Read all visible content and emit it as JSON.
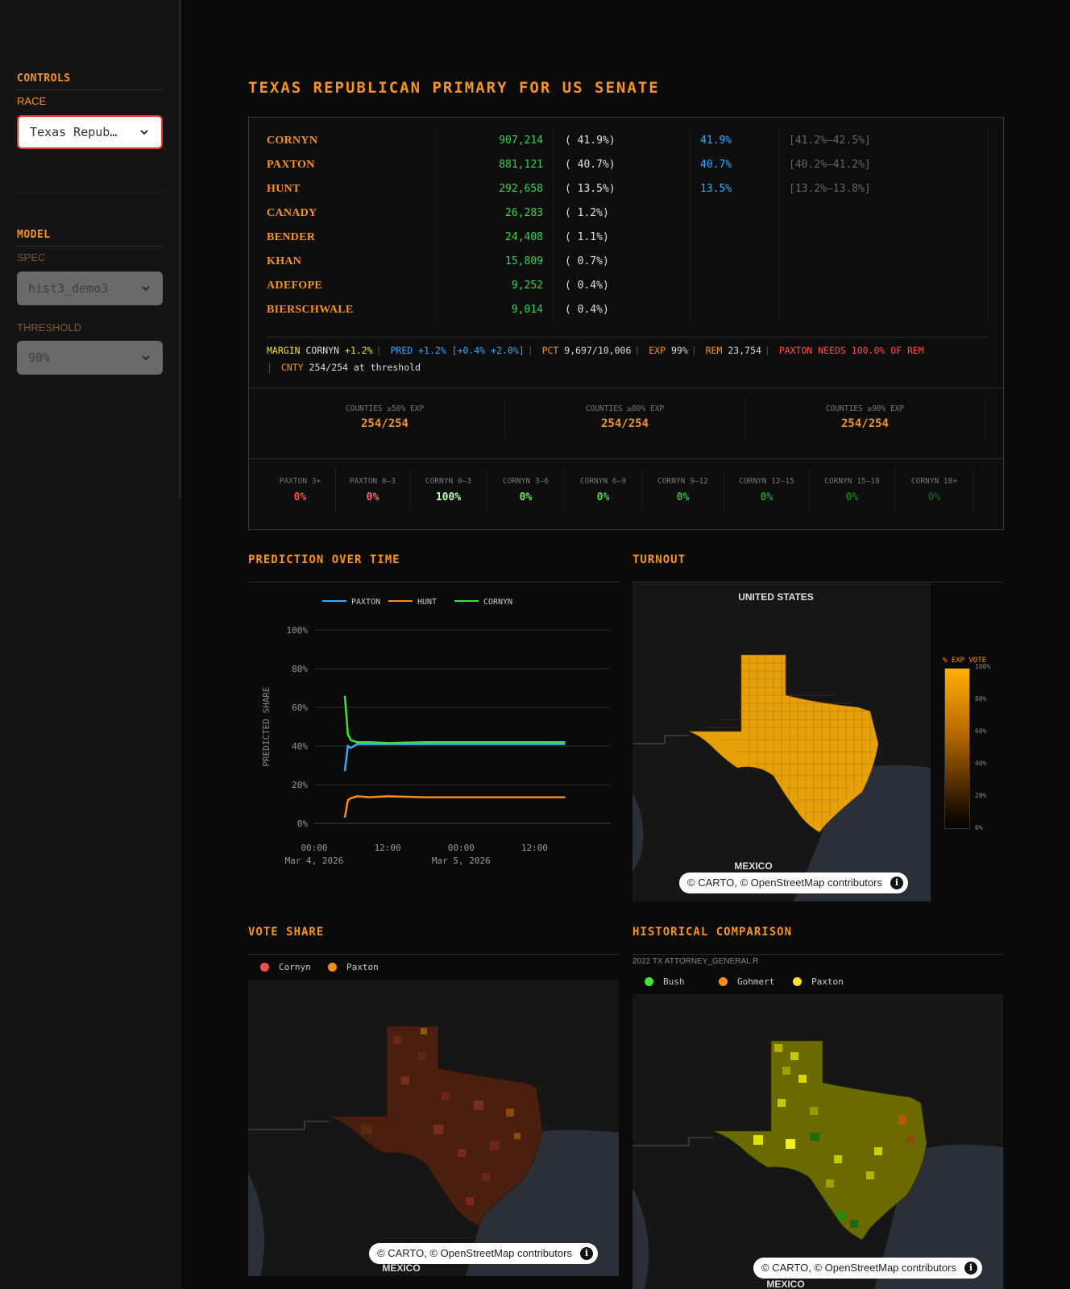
{
  "sidebar": {
    "controls_title": "CONTROLS",
    "race_label": "RACE",
    "race_value": "Texas Repub…",
    "model_title": "MODEL",
    "spec_label": "SPEC",
    "spec_value": "hist3_demo3",
    "threshold_label": "THRESHOLD",
    "threshold_value": "90%"
  },
  "page_title": "TEXAS REPUBLICAN PRIMARY FOR US SENATE",
  "candidates": [
    {
      "name": "CORNYN",
      "votes": "907,214",
      "pct": "( 41.9%)",
      "pred": "41.9%",
      "ci": "[41.2%–42.5%]"
    },
    {
      "name": "PAXTON",
      "votes": "881,121",
      "pct": "( 40.7%)",
      "pred": "40.7%",
      "ci": "[40.2%–41.2%]"
    },
    {
      "name": "HUNT",
      "votes": "292,658",
      "pct": "( 13.5%)",
      "pred": "13.5%",
      "ci": "[13.2%–13.8%]"
    },
    {
      "name": "CANADY",
      "votes": "26,283",
      "pct": "( 1.2%)",
      "pred": "",
      "ci": ""
    },
    {
      "name": "BENDER",
      "votes": "24,408",
      "pct": "( 1.1%)",
      "pred": "",
      "ci": ""
    },
    {
      "name": "KHAN",
      "votes": "15,809",
      "pct": "( 0.7%)",
      "pred": "",
      "ci": ""
    },
    {
      "name": "ADEFOPE",
      "votes": "9,252",
      "pct": "( 0.4%)",
      "pred": "",
      "ci": ""
    },
    {
      "name": "BIERSCHWALE",
      "votes": "9,014",
      "pct": "( 0.4%)",
      "pred": "",
      "ci": ""
    }
  ],
  "status": {
    "margin_label": "MARGIN",
    "margin_cand": "CORNYN",
    "margin_val": "+1.2%",
    "pred_label": "PRED",
    "pred_val": "+1.2%",
    "pred_ci": "[+0.4% +2.0%]",
    "pct_label": "PCT",
    "pct_val": "9,697/10,006",
    "exp_label": "EXP",
    "exp_val": "99%",
    "rem_label": "REM",
    "rem_val": "23,754",
    "needs": "PAXTON NEEDS 100.0% OF REM",
    "cnty_label": "CNTY",
    "cnty_val": "254/254 at threshold"
  },
  "exp_counts": [
    {
      "label": "COUNTIES ≥50% EXP",
      "value": "254/254"
    },
    {
      "label": "COUNTIES ≥80% EXP",
      "value": "254/254"
    },
    {
      "label": "COUNTIES ≥90% EXP",
      "value": "254/254"
    }
  ],
  "buckets": [
    {
      "label": "PAXTON 3+",
      "value": "0%",
      "color": "#ff4d4d"
    },
    {
      "label": "PAXTON 0–3",
      "value": "0%",
      "color": "#ff6b6b"
    },
    {
      "label": "CORNYN 0–3",
      "value": "100%",
      "color": "#b8ffb0"
    },
    {
      "label": "CORNYN 3–6",
      "value": "0%",
      "color": "#6cf06c"
    },
    {
      "label": "CORNYN 6–9",
      "value": "0%",
      "color": "#4fd24f"
    },
    {
      "label": "CORNYN 9–12",
      "value": "0%",
      "color": "#3cb83c"
    },
    {
      "label": "CORNYN 12–15",
      "value": "0%",
      "color": "#2e962e"
    },
    {
      "label": "CORNYN 15–18",
      "value": "0%",
      "color": "#237423"
    },
    {
      "label": "CORNYN 18+",
      "value": "0%",
      "color": "#1a561a"
    }
  ],
  "sections": {
    "prediction": "PREDICTION OVER TIME",
    "turnout": "TURNOUT",
    "vote_share": "VOTE SHARE",
    "historical": "HISTORICAL COMPARISON"
  },
  "chart_data": {
    "type": "line",
    "title": "",
    "ylabel": "PREDICTED SHARE",
    "xlabel": "",
    "ylim": [
      0,
      100
    ],
    "yticks": [
      "100%",
      "80%",
      "60%",
      "40%",
      "20%",
      "0%"
    ],
    "xticks": [
      {
        "time": "00:00",
        "date": "Mar 4, 2026"
      },
      {
        "time": "12:00",
        "date": ""
      },
      {
        "time": "00:00",
        "date": "Mar 5, 2026"
      },
      {
        "time": "12:00",
        "date": ""
      }
    ],
    "x": [
      "2026-03-04 05:00",
      "2026-03-04 05:30",
      "2026-03-04 06:00",
      "2026-03-04 07:00",
      "2026-03-04 09:00",
      "2026-03-04 12:00",
      "2026-03-04 18:00",
      "2026-03-05 00:00",
      "2026-03-05 06:00",
      "2026-03-05 12:00",
      "2026-03-05 17:00"
    ],
    "series": [
      {
        "name": "PAXTON",
        "color": "#33aaff",
        "values": [
          27,
          40,
          39,
          41,
          41,
          41,
          41,
          41,
          41,
          41,
          41
        ]
      },
      {
        "name": "HUNT",
        "color": "#ff8c1a",
        "values": [
          3,
          12,
          13,
          14,
          13.5,
          14,
          13.5,
          13.5,
          13.5,
          13.5,
          13.5
        ]
      },
      {
        "name": "CORNYN",
        "color": "#39e639",
        "values": [
          66,
          46,
          43,
          42,
          42,
          41.5,
          42,
          42,
          42,
          42,
          42
        ]
      }
    ]
  },
  "turnout_map": {
    "country_label_us": "UNITED STATES",
    "country_label_mx": "MEXICO",
    "legend_title": "% EXP VOTE",
    "legend_ticks": [
      "100%",
      "80%",
      "60%",
      "40%",
      "20%",
      "0%"
    ],
    "attribution": "© CARTO, © OpenStreetMap contributors"
  },
  "vote_share_map": {
    "legend": [
      {
        "name": "Cornyn",
        "color": "#ff4d4d"
      },
      {
        "name": "Paxton",
        "color": "#ff8c1a"
      }
    ],
    "country_label_mx": "MEXICO",
    "attribution": "© CARTO, © OpenStreetMap contributors"
  },
  "historical_map": {
    "caption": "2022 TX ATTORNEY_GENERAL R",
    "legend": [
      {
        "name": "Bush",
        "color": "#39e639"
      },
      {
        "name": "Gohmert",
        "color": "#ff8c1a"
      },
      {
        "name": "Paxton",
        "color": "#f5e133"
      }
    ],
    "country_label_mx": "MEXICO",
    "attribution": "© CARTO, © OpenStreetMap contributors"
  }
}
